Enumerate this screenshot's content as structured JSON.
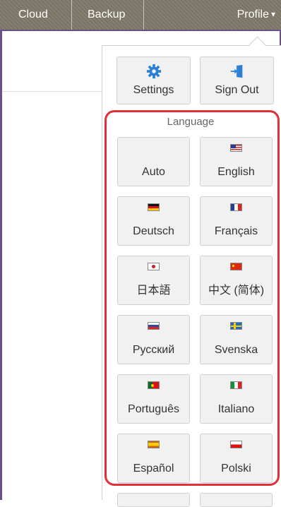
{
  "nav": {
    "tabs": [
      "Cloud",
      "Backup"
    ],
    "profile_label": "Profile",
    "profile_caret": "▾"
  },
  "profile_menu": {
    "settings_label": "Settings",
    "signout_label": "Sign Out",
    "language_heading": "Language",
    "languages": [
      {
        "label": "Auto",
        "flag": "none"
      },
      {
        "label": "English",
        "flag": "us"
      },
      {
        "label": "Deutsch",
        "flag": "de"
      },
      {
        "label": "Français",
        "flag": "fr"
      },
      {
        "label": "日本語",
        "flag": "jp"
      },
      {
        "label": "中文 (简体)",
        "flag": "cn"
      },
      {
        "label": "Русский",
        "flag": "ru"
      },
      {
        "label": "Svenska",
        "flag": "se"
      },
      {
        "label": "Português",
        "flag": "pt"
      },
      {
        "label": "Italiano",
        "flag": "it"
      },
      {
        "label": "Español",
        "flag": "es"
      },
      {
        "label": "Polski",
        "flag": "pl"
      }
    ]
  },
  "colors": {
    "topbar": "#80796a",
    "frame": "#6a4f8c",
    "highlight": "#e2303a",
    "icon_blue": "#2b7fd4"
  },
  "icons": {
    "settings": "gear-icon",
    "signout": "sign-out-door-icon"
  }
}
